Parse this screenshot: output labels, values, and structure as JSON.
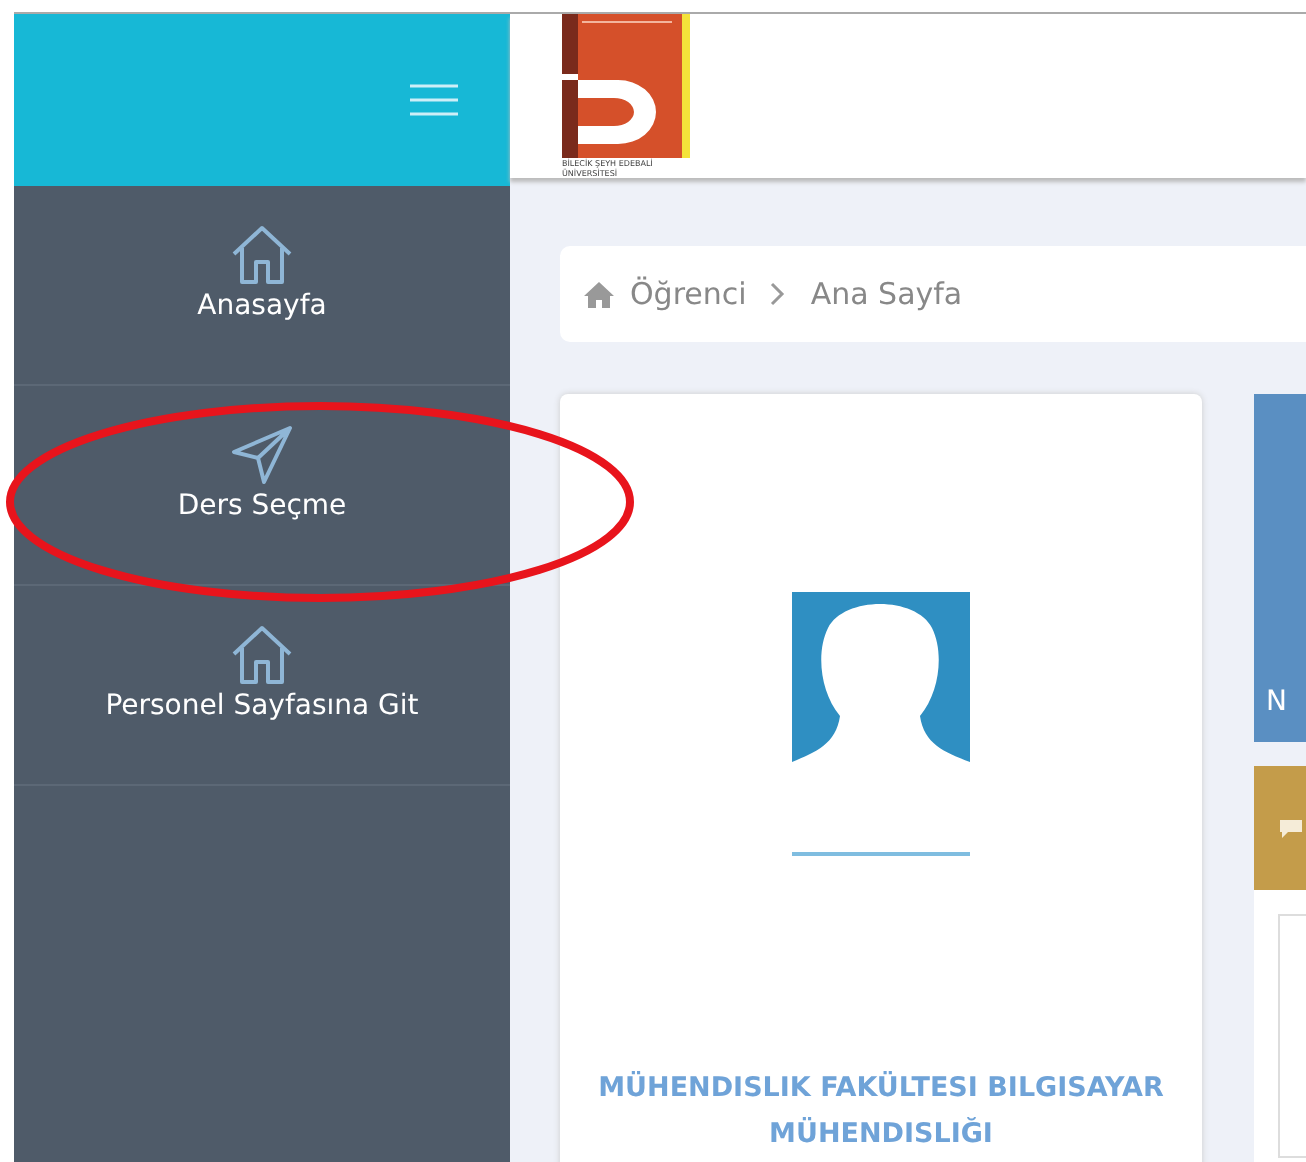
{
  "sidebar": {
    "items": [
      {
        "label": "Anasayfa",
        "kind": "home"
      },
      {
        "label": "Ders Seçme",
        "kind": "send"
      },
      {
        "label": "Personel Sayfasına Git",
        "kind": "home"
      }
    ]
  },
  "header": {
    "logo": {
      "line_1": "BİLECİK ŞEYH EDEBALİ",
      "line_2": "ÜNİVERSİTESİ"
    }
  },
  "breadcrumb": [
    "Öğrenci",
    "Ana Sayfa"
  ],
  "profile": {
    "department": "MÜHENDISLIK FAKÜLTESI BILGISAYAR MÜHENDISLIĞI"
  },
  "side_cards": [
    {
      "kind": "info",
      "text": "N"
    },
    {
      "kind": "messages"
    }
  ],
  "annotations": [
    {
      "kind": "ellipse"
    }
  ]
}
